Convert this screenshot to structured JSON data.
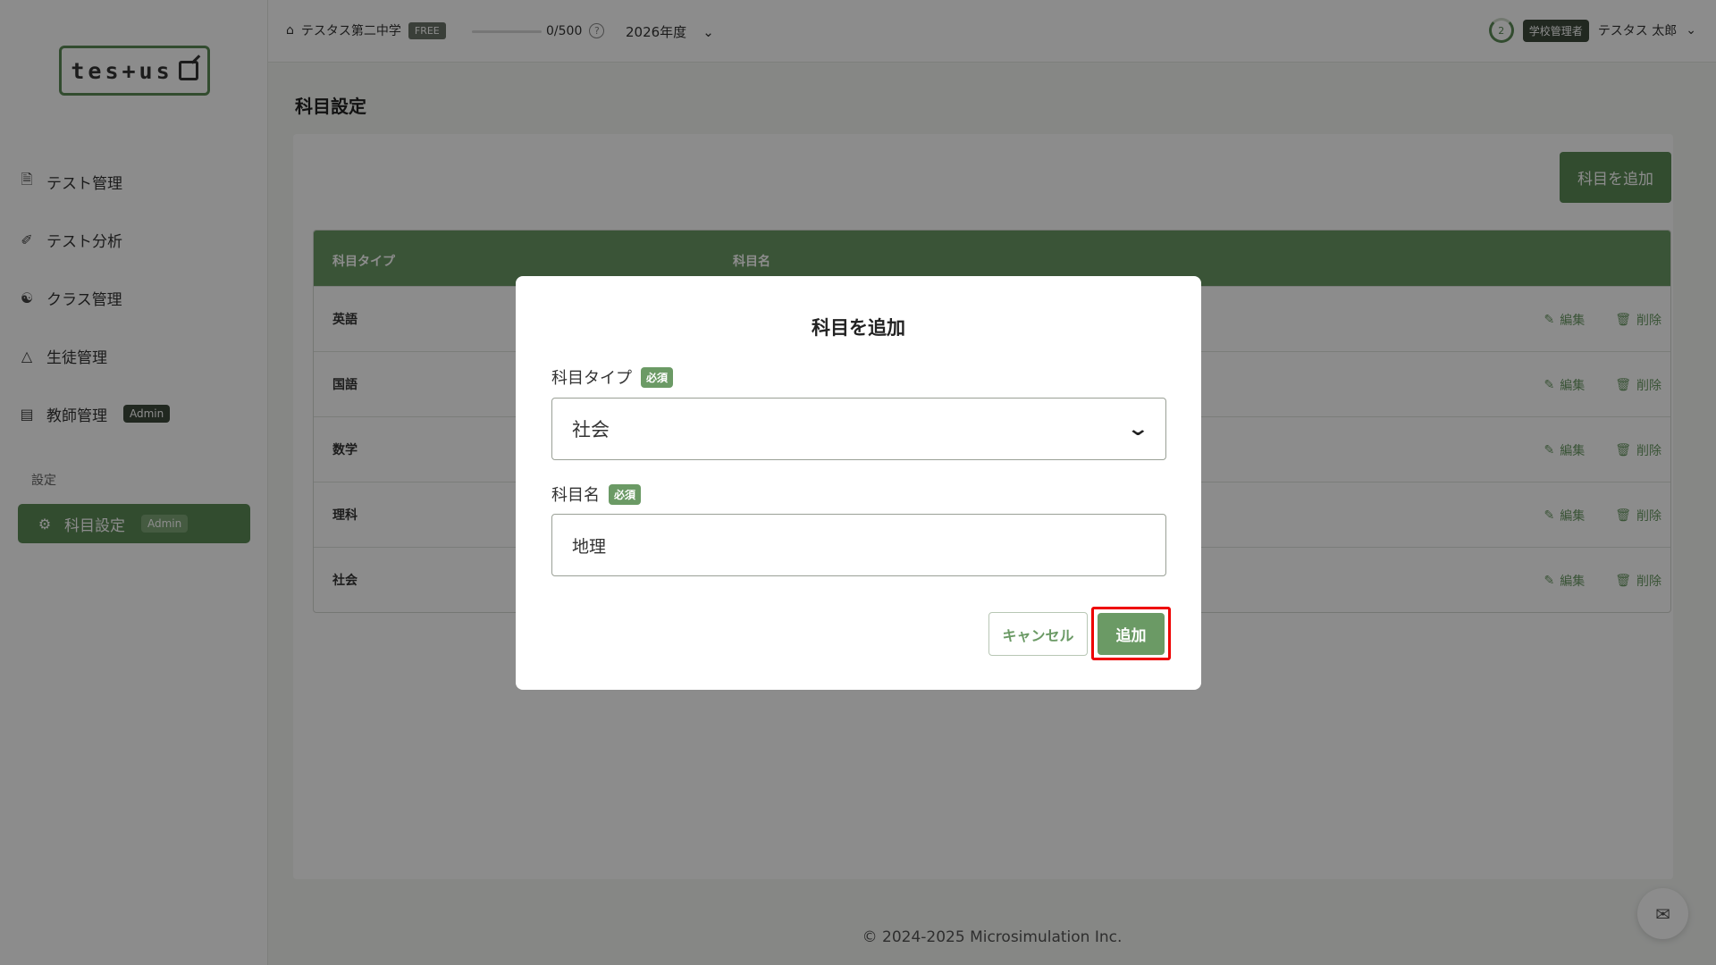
{
  "logo": {
    "text": "tes+us"
  },
  "sidebar": {
    "items": [
      {
        "label": "テスト管理",
        "icon": "document-icon"
      },
      {
        "label": "テスト分析",
        "icon": "analysis-icon"
      },
      {
        "label": "クラス管理",
        "icon": "class-icon"
      },
      {
        "label": "生徒管理",
        "icon": "graduation-cap-icon"
      },
      {
        "label": "教師管理",
        "icon": "teacher-icon",
        "badge": "Admin"
      }
    ],
    "section_label": "設定",
    "active_item": {
      "label": "科目設定",
      "icon": "gear-icon",
      "badge": "Admin"
    }
  },
  "topbar": {
    "school_name": "テスタス第二中学",
    "plan_badge": "FREE",
    "usage": "0/500",
    "year": "2026年度",
    "ring_value": "2",
    "role": "学校管理者",
    "user_name": "テスタス 太郎"
  },
  "page": {
    "title": "科目設定",
    "add_button": "科目を追加"
  },
  "table": {
    "columns": [
      "科目タイプ",
      "科目名"
    ],
    "rows": [
      {
        "type": "英語"
      },
      {
        "type": "国語"
      },
      {
        "type": "数学"
      },
      {
        "type": "理科"
      },
      {
        "type": "社会"
      }
    ],
    "edit_label": "編集",
    "delete_label": "削除"
  },
  "modal": {
    "title": "科目を追加",
    "type_label": "科目タイプ",
    "required_badge": "必須",
    "type_value": "社会",
    "name_label": "科目名",
    "name_value": "地理",
    "cancel_label": "キャンセル",
    "submit_label": "追加"
  },
  "footer": {
    "copyright": "© 2024-2025 Microsimulation Inc."
  },
  "colors": {
    "accent": "#6b9a65",
    "highlight": "#ee0000"
  }
}
